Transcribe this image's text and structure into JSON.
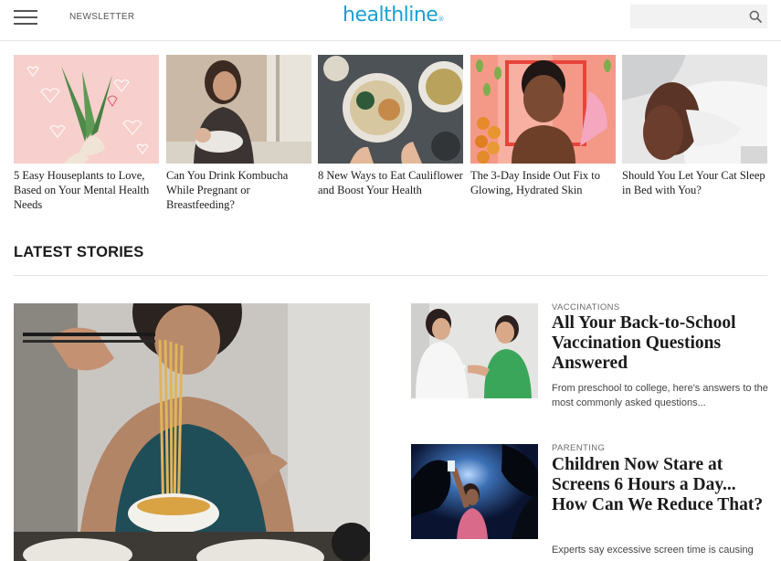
{
  "header": {
    "newsletter_label": "NEWSLETTER",
    "logo_text": "healthline",
    "logo_mark": "®",
    "search_placeholder": "",
    "brand_color": "#1b9fd3"
  },
  "top_stories": [
    {
      "title": "5 Easy Houseplants to Love, Based on Your Mental Health Needs",
      "image": "aloe-plant-illustration"
    },
    {
      "title": "Can You Drink Kombucha While Pregnant or Breastfeeding?",
      "image": "mother-breastfeeding-photo"
    },
    {
      "title": "8 New Ways to Eat Cauliflower and Boost Your Health",
      "image": "cauliflower-dishes-photo"
    },
    {
      "title": "The 3-Day Inside Out Fix to Glowing, Hydrated Skin",
      "image": "woman-skin-collage"
    },
    {
      "title": "Should You Let Your Cat Sleep in Bed with You?",
      "image": "woman-sleeping-bed-photo"
    }
  ],
  "latest": {
    "section_title": "LATEST STORIES",
    "hero_image": "woman-eating-noodles-photo",
    "stories": [
      {
        "category": "VACCINATIONS",
        "title": "All Your Back-to-School Vaccination Questions Answered",
        "description": "From preschool to college, here's answers to the most commonly asked questions...",
        "image": "doctor-vaccinating-child-photo"
      },
      {
        "category": "PARENTING",
        "title": "Children Now Stare at Screens 6 Hours a Day... How Can We Reduce That?",
        "description": "Experts say excessive screen time is causing",
        "image": "child-with-phone-night-photo"
      }
    ]
  }
}
